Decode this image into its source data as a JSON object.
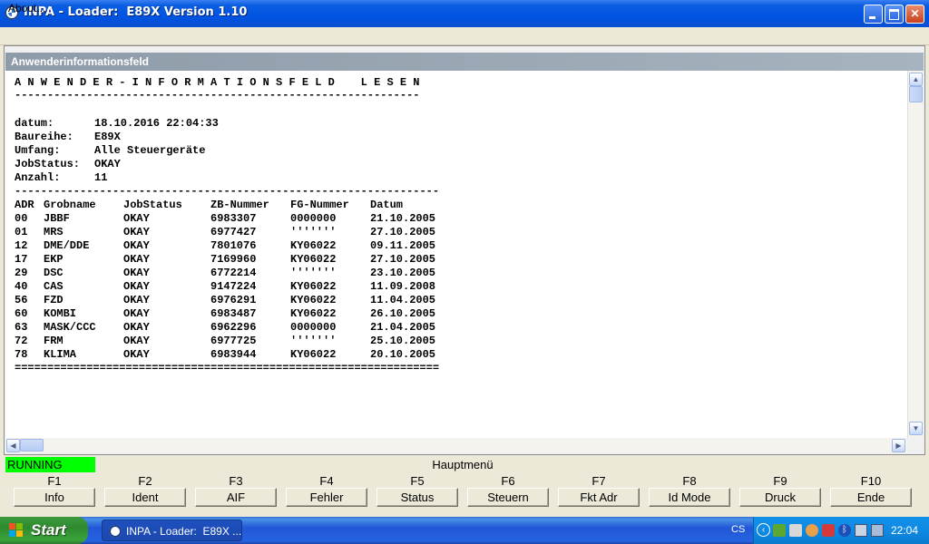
{
  "window": {
    "title": "INPA - Loader:  E89X Version 1.10",
    "menu": [
      "About..."
    ]
  },
  "panel": {
    "caption": "Anwenderinformationsfeld"
  },
  "report": {
    "heading": "A N W E N D E R - I N F O R M A T I O N S F E L D    L E S E N",
    "rule_dash": "--------------------------------------------------------------",
    "rule_dash_long": "-----------------------------------------------------------------",
    "rule_double": "=================================================================",
    "info": [
      {
        "label": "datum:",
        "value": "18.10.2016 22:04:33"
      },
      {
        "label": "Baureihe:",
        "value": "E89X"
      },
      {
        "label": "Umfang:",
        "value": "Alle Steuergeräte"
      },
      {
        "label": "JobStatus:",
        "value": "OKAY"
      },
      {
        "label": "Anzahl:",
        "value": "11"
      }
    ],
    "columns": [
      "ADR",
      "Grobname",
      "JobStatus",
      "ZB-Nummer",
      "FG-Nummer",
      "Datum"
    ],
    "rows": [
      [
        "00",
        "JBBF",
        "OKAY",
        "6983307",
        "0000000",
        "21.10.2005"
      ],
      [
        "01",
        "MRS",
        "OKAY",
        "6977427",
        "'''''''",
        "27.10.2005"
      ],
      [
        "12",
        "DME/DDE",
        "OKAY",
        "7801076",
        "KY06022",
        "09.11.2005"
      ],
      [
        "17",
        "EKP",
        "OKAY",
        "7169960",
        "KY06022",
        "27.10.2005"
      ],
      [
        "29",
        "DSC",
        "OKAY",
        "6772214",
        "'''''''",
        "23.10.2005"
      ],
      [
        "40",
        "CAS",
        "OKAY",
        "9147224",
        "KY06022",
        "11.09.2008"
      ],
      [
        "56",
        "FZD",
        "OKAY",
        "6976291",
        "KY06022",
        "11.04.2005"
      ],
      [
        "60",
        "KOMBI",
        "OKAY",
        "6983487",
        "KY06022",
        "26.10.2005"
      ],
      [
        "63",
        "MASK/CCC",
        "OKAY",
        "6962296",
        "0000000",
        "21.04.2005"
      ],
      [
        "72",
        "FRM",
        "OKAY",
        "6977725",
        "'''''''",
        "25.10.2005"
      ],
      [
        "78",
        "KLIMA",
        "OKAY",
        "6983944",
        "KY06022",
        "20.10.2005"
      ]
    ]
  },
  "status": {
    "state": "RUNNING",
    "state_color": "#00ff00",
    "menu_name": "Hauptmenü"
  },
  "function_keys": [
    {
      "key": "F1",
      "label": "Info"
    },
    {
      "key": "F2",
      "label": "Ident"
    },
    {
      "key": "F3",
      "label": "AIF"
    },
    {
      "key": "F4",
      "label": "Fehler"
    },
    {
      "key": "F5",
      "label": "Status"
    },
    {
      "key": "F6",
      "label": "Steuern"
    },
    {
      "key": "F7",
      "label": "Fkt Adr"
    },
    {
      "key": "F8",
      "label": "Id Mode"
    },
    {
      "key": "F9",
      "label": "Druck"
    },
    {
      "key": "F10",
      "label": "Ende"
    }
  ],
  "taskbar": {
    "start_label": "Start",
    "task_label": "INPA - Loader:  E89X ...",
    "language": "CS",
    "clock": "22:04",
    "tray_icons": [
      "network-icon",
      "antivirus-icon",
      "security-shield-icon",
      "bluetooth-icon",
      "display-icon",
      "monitor-icon"
    ]
  }
}
